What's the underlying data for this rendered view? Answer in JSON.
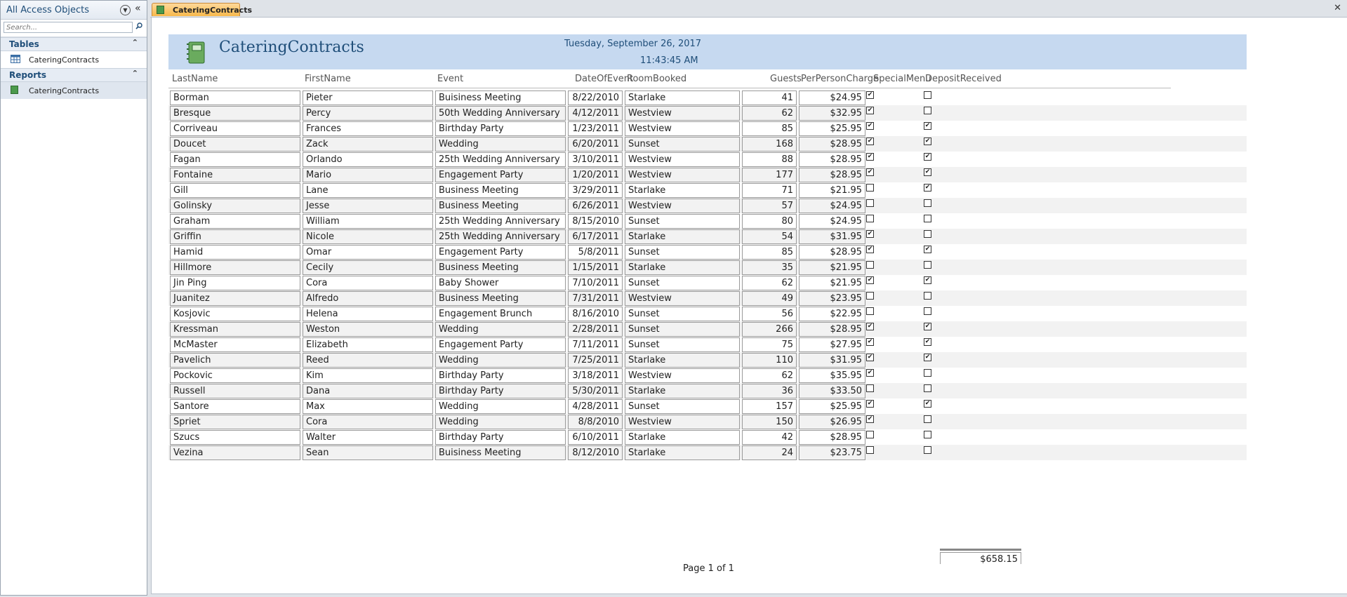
{
  "nav": {
    "title": "All Access Objects",
    "search_placeholder": "Search...",
    "groups": [
      {
        "label": "Tables",
        "items": [
          "CateringContracts"
        ]
      },
      {
        "label": "Reports",
        "items": [
          "CateringContracts"
        ]
      }
    ]
  },
  "tab": {
    "label": "CateringContracts"
  },
  "report": {
    "title": "CateringContracts",
    "date": "Tuesday, September 26, 2017",
    "time": "11:43:45 AM",
    "columns": [
      "LastName",
      "FirstName",
      "Event",
      "DateOfEvent",
      "RoomBooked",
      "Guests",
      "PerPersonCharge",
      "SpecialMenu",
      "DepositReceived"
    ],
    "rows": [
      [
        "Borman",
        "Pieter",
        "Buisiness Meeting",
        "8/22/2010",
        "Starlake",
        "41",
        "$24.95",
        true,
        false
      ],
      [
        "Bresque",
        "Percy",
        "50th Wedding Anniversary",
        "4/12/2011",
        "Westview",
        "62",
        "$32.95",
        true,
        false
      ],
      [
        "Corriveau",
        "Frances",
        "Birthday Party",
        "1/23/2011",
        "Westview",
        "85",
        "$25.95",
        true,
        true
      ],
      [
        "Doucet",
        "Zack",
        "Wedding",
        "6/20/2011",
        "Sunset",
        "168",
        "$28.95",
        true,
        true
      ],
      [
        "Fagan",
        "Orlando",
        "25th Wedding Anniversary",
        "3/10/2011",
        "Westview",
        "88",
        "$28.95",
        true,
        true
      ],
      [
        "Fontaine",
        "Mario",
        "Engagement Party",
        "1/20/2011",
        "Westview",
        "177",
        "$28.95",
        true,
        true
      ],
      [
        "Gill",
        "Lane",
        "Business Meeting",
        "3/29/2011",
        "Starlake",
        "71",
        "$21.95",
        false,
        true
      ],
      [
        "Golinsky",
        "Jesse",
        "Business Meeting",
        "6/26/2011",
        "Westview",
        "57",
        "$24.95",
        false,
        false
      ],
      [
        "Graham",
        "William",
        "25th Wedding Anniversary",
        "8/15/2010",
        "Sunset",
        "80",
        "$24.95",
        false,
        false
      ],
      [
        "Griffin",
        "Nicole",
        "25th Wedding Anniversary",
        "6/17/2011",
        "Starlake",
        "54",
        "$31.95",
        true,
        false
      ],
      [
        "Hamid",
        "Omar",
        "Engagement Party",
        "5/8/2011",
        "Sunset",
        "85",
        "$28.95",
        true,
        true
      ],
      [
        "Hillmore",
        "Cecily",
        "Business Meeting",
        "1/15/2011",
        "Starlake",
        "35",
        "$21.95",
        false,
        false
      ],
      [
        "Jin Ping",
        "Cora",
        "Baby Shower",
        "7/10/2011",
        "Sunset",
        "62",
        "$21.95",
        true,
        true
      ],
      [
        "Juanitez",
        "Alfredo",
        "Business Meeting",
        "7/31/2011",
        "Westview",
        "49",
        "$23.95",
        false,
        false
      ],
      [
        "Kosjovic",
        "Helena",
        "Engagement Brunch",
        "8/16/2010",
        "Sunset",
        "56",
        "$22.95",
        false,
        false
      ],
      [
        "Kressman",
        "Weston",
        "Wedding",
        "2/28/2011",
        "Sunset",
        "266",
        "$28.95",
        true,
        true
      ],
      [
        "McMaster",
        "Elizabeth",
        "Engagement Party",
        "7/11/2011",
        "Sunset",
        "75",
        "$27.95",
        true,
        true
      ],
      [
        "Pavelich",
        "Reed",
        "Wedding",
        "7/25/2011",
        "Starlake",
        "110",
        "$31.95",
        true,
        true
      ],
      [
        "Pockovic",
        "Kim",
        "Birthday Party",
        "3/18/2011",
        "Westview",
        "62",
        "$35.95",
        true,
        false
      ],
      [
        "Russell",
        "Dana",
        "Birthday Party",
        "5/30/2011",
        "Starlake",
        "36",
        "$33.50",
        false,
        false
      ],
      [
        "Santore",
        "Max",
        "Wedding",
        "4/28/2011",
        "Sunset",
        "157",
        "$25.95",
        true,
        true
      ],
      [
        "Spriet",
        "Cora",
        "Wedding",
        "8/8/2010",
        "Westview",
        "150",
        "$26.95",
        true,
        false
      ],
      [
        "Szucs",
        "Walter",
        "Birthday Party",
        "6/10/2011",
        "Starlake",
        "42",
        "$28.95",
        false,
        false
      ],
      [
        "Vezina",
        "Sean",
        "Buisiness Meeting",
        "8/12/2010",
        "Starlake",
        "24",
        "$23.75",
        false,
        false
      ]
    ],
    "total": "$658.15",
    "page_label": "Page 1 of 1"
  },
  "colors": {
    "banner": "#c6d9f0",
    "title": "#1f4e79",
    "tab": "#f7b84b"
  }
}
